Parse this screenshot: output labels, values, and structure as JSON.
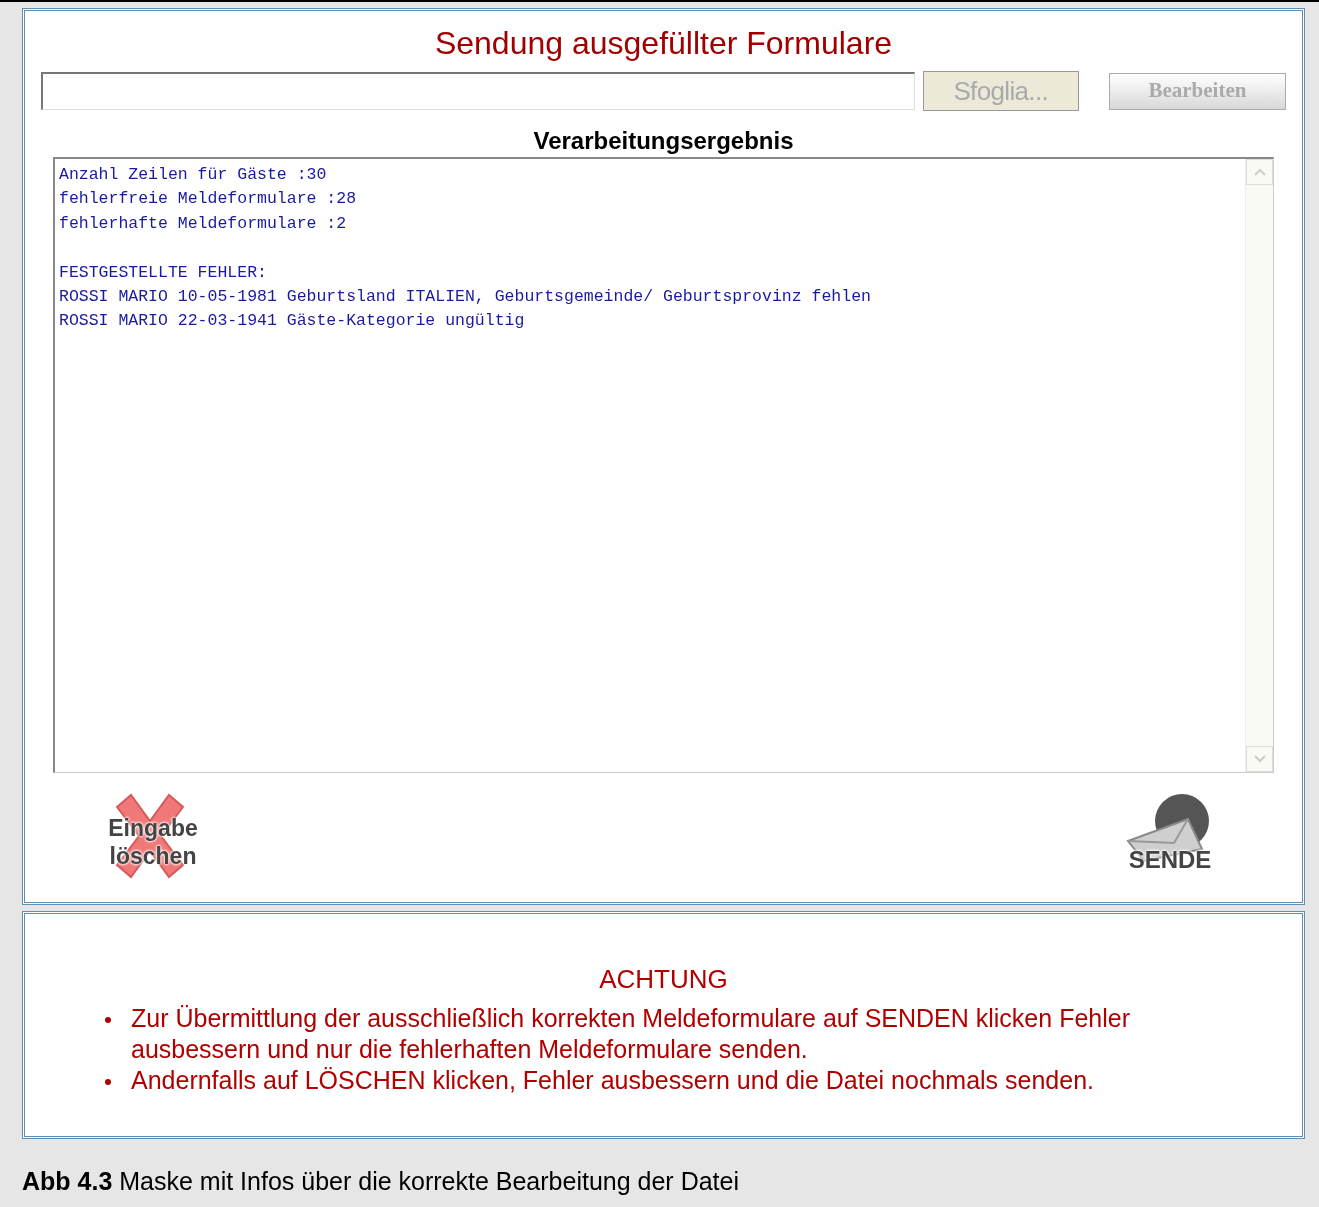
{
  "form": {
    "title": "Sendung ausgefüllter Formulare",
    "browse_button": "Sfoglia...",
    "process_button": "Bearbeiten"
  },
  "result": {
    "heading": "Verarbeitungsergebnis",
    "blocks": [
      [
        "Anzahl Zeilen für Gäste :30",
        "fehlerfreie Meldeformulare :28",
        "fehlerhafte Meldeformulare :2"
      ],
      [
        "FESTGESTELLTE FEHLER:",
        "ROSSI MARIO 10-05-1981 Geburtsland ITALIEN, Geburtsgemeinde/ Geburtsprovinz fehlen",
        "ROSSI MARIO 22-03-1941 Gäste-Kategorie ungültig"
      ]
    ]
  },
  "actions": {
    "delete_button": [
      "Eingabe",
      "löschen"
    ],
    "send_button": "SENDE"
  },
  "notice": {
    "title": "ACHTUNG",
    "items": [
      "Zur Übermittlung der ausschließlich korrekten Meldeformulare auf SENDEN klicken Fehler ausbessern und nur die fehlerhaften Meldeformulare senden.",
      "Andernfalls auf LÖSCHEN klicken, Fehler ausbessern und die Datei nochmals senden."
    ]
  },
  "caption": {
    "label": "Abb 4.3",
    "text": "Maske mit Infos über die korrekte Bearbeitung der Datei"
  }
}
